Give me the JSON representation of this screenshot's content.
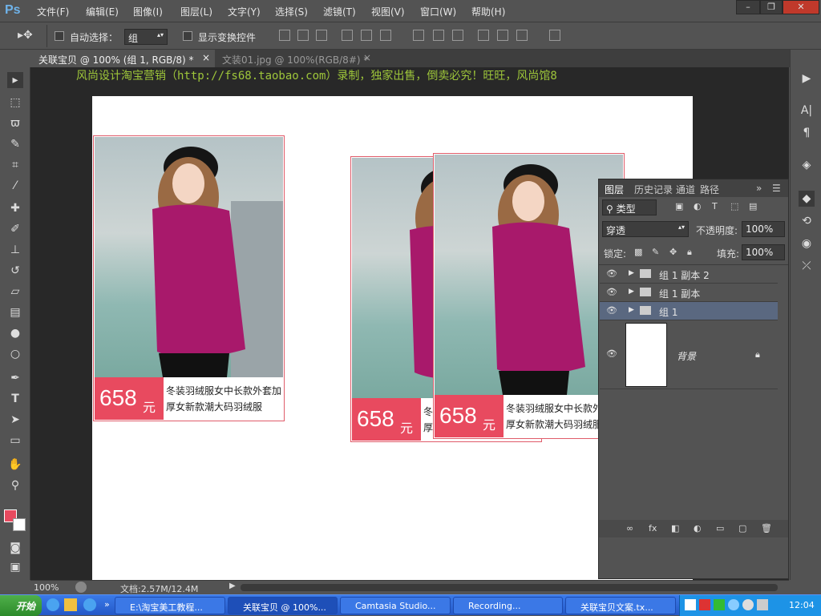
{
  "app": {
    "logo": "Ps"
  },
  "menu": [
    "文件(F)",
    "编辑(E)",
    "图像(I)",
    "图层(L)",
    "文字(Y)",
    "选择(S)",
    "滤镜(T)",
    "视图(V)",
    "窗口(W)",
    "帮助(H)"
  ],
  "options": {
    "auto_select_label": "自动选择：",
    "auto_select_value": "组",
    "show_transform_label": "显示变换控件"
  },
  "tabs": [
    {
      "label": "关联宝贝 @ 100% (组 1, RGB/8) *"
    },
    {
      "label": "文装01.jpg @ 100%(RGB/8#) *"
    }
  ],
  "watermark": "风尚设计淘宝营销（http://fs68.taobao.com）录制，独家出售，倒卖必究！旺旺，风尚馆8",
  "product": {
    "price": "658",
    "currency": "元",
    "description": "冬装羽绒服女中长款外套加厚女新款潮大码羽绒服",
    "desc_line1": "冬装羽绒服女中长款外套加",
    "desc_line2": "厚女新款潮大码羽绒服"
  },
  "layers_panel": {
    "tabs": [
      "图层",
      "历史记录",
      "通道",
      "路径"
    ],
    "filter_label": "类型",
    "blend_mode": "穿透",
    "opacity_label": "不透明度:",
    "opacity_value": "100%",
    "lock_label": "锁定:",
    "fill_label": "填充:",
    "fill_value": "100%",
    "layers": [
      {
        "name": "组 1 副本 2",
        "selected": false
      },
      {
        "name": "组 1 副本",
        "selected": false
      },
      {
        "name": "组 1",
        "selected": true
      }
    ],
    "background_layer": "背景"
  },
  "status": {
    "zoom": "100%",
    "doc_info": "文档:2.57M/12.4M"
  },
  "taskbar": {
    "start": "开始",
    "tasks": [
      "E:\\淘宝美工教程...",
      "关联宝贝 @ 100%...",
      "Camtasia Studio...",
      "Recording...",
      "关联宝贝文案.tx..."
    ],
    "clock": "12:04"
  },
  "colors": {
    "accent_price": "#e84a5f",
    "foreground": "#e84a5f",
    "background": "#ffffff"
  }
}
